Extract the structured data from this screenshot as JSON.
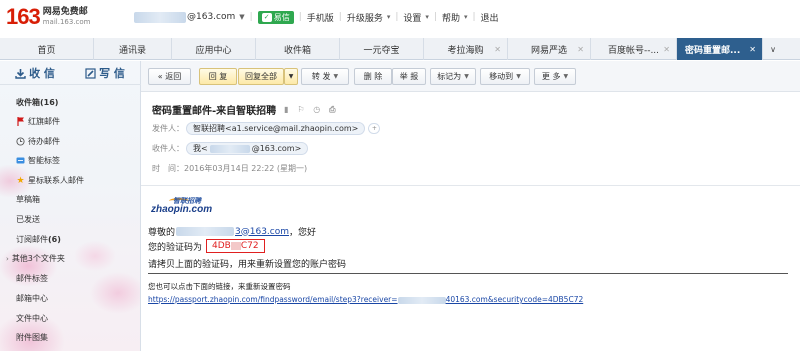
{
  "header": {
    "logo_num": "163",
    "logo_title": "网易免费邮",
    "logo_sub": "mail.163.com",
    "user_suffix": "@163.com",
    "yixin": "易信",
    "links": [
      "手机版",
      "升级服务",
      "设置",
      "帮助",
      "退出"
    ]
  },
  "tabs": [
    {
      "label": "首页",
      "closable": false
    },
    {
      "label": "通讯录",
      "closable": false
    },
    {
      "label": "应用中心",
      "closable": false
    },
    {
      "label": "收件箱",
      "closable": false
    },
    {
      "label": "一元夺宝",
      "closable": false
    },
    {
      "label": "考拉海购",
      "closable": true
    },
    {
      "label": "网易严选",
      "closable": true
    },
    {
      "label": "百度帐号--...",
      "closable": true
    },
    {
      "label": "密码重置邮...",
      "closable": true,
      "active": true
    }
  ],
  "sidebar": {
    "receive": "收 信",
    "write": "写 信",
    "folders": [
      {
        "label": "收件箱",
        "count": "(16)"
      },
      {
        "label": "红旗邮件",
        "icon": "flag-icon"
      },
      {
        "label": "待办邮件",
        "icon": "clock-icon"
      },
      {
        "label": "智能标签",
        "icon": "tag-icon"
      },
      {
        "label": "星标联系人邮件",
        "icon": "star-icon"
      },
      {
        "label": "草稿箱"
      },
      {
        "label": "已发送"
      },
      {
        "label": "订阅邮件",
        "count": "(6)"
      },
      {
        "label": "其他3个文件夹",
        "expand": true
      },
      {
        "label": "邮件标签"
      },
      {
        "label": "邮箱中心"
      },
      {
        "label": "文件中心"
      },
      {
        "label": "附件图集"
      }
    ]
  },
  "toolbar": {
    "back": "« 返回",
    "reply": "回 复",
    "reply_all": "回复全部",
    "forward": "转 发",
    "delete": "删 除",
    "report": "举 报",
    "mark_as": "标记为",
    "move_to": "移动到",
    "more": "更 多"
  },
  "mail": {
    "subject": "密码重置邮件-来自智联招聘",
    "from_label": "发件人：",
    "from_value": "智联招聘<a1.service@mail.zhaopin.com>",
    "to_label": "收件人：",
    "to_prefix": "我<",
    "to_suffix": "@163.com>",
    "time_label": "时　间：",
    "time_value": "2016年03月14日 22:22 (星期一)",
    "logo_cn": "智联招聘",
    "logo_en": "zhaopin.com",
    "greeting_prefix": "尊敬的",
    "greeting_email_tail": "3@163.com",
    "greeting_suffix": "，您好",
    "code_label": "您的验证码为",
    "code_start": "4DB",
    "code_end": "C72",
    "instruction": "请拷贝上面的验证码，用来重新设置您的账户密码",
    "alt_text": "您也可以点击下面的链接，来重新设置密码",
    "link_start": "https://passport.zhaopin.com/findpassword/email/step3?receiver=",
    "link_end": "40163.com&securitycode=4DB5C72"
  }
}
